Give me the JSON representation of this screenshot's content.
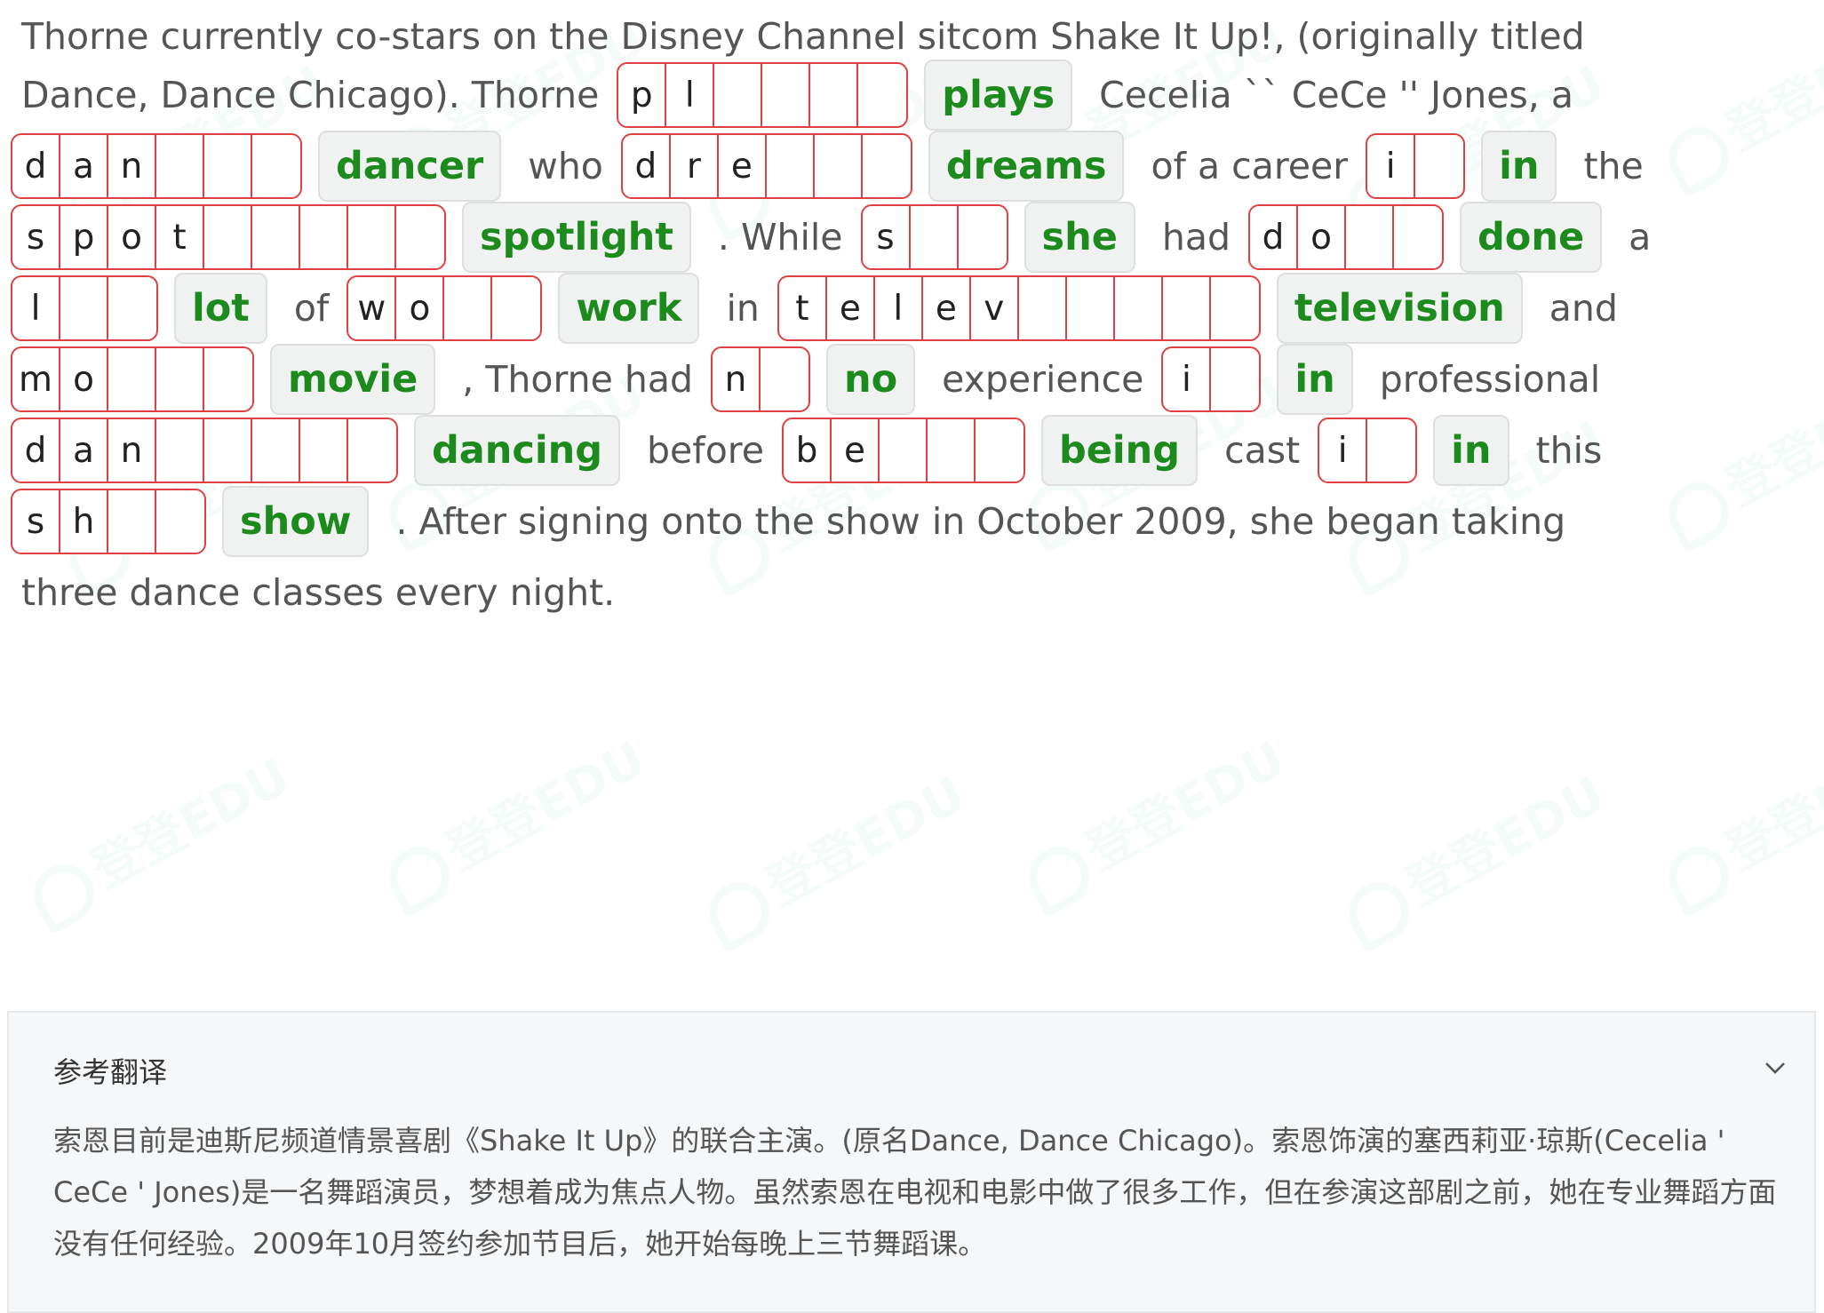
{
  "line1_text": "Thorne currently co-stars on the Disney Channel sitcom Shake It Up!, (originally titled",
  "line2": {
    "pre": "Dance, Dance Chicago). Thorne",
    "blank": {
      "letters": [
        "p",
        "l",
        "",
        "",
        "",
        ""
      ],
      "answer": "plays"
    },
    "post": "Cecelia `` CeCe '' Jones, a"
  },
  "line3": {
    "b1": {
      "letters": [
        "d",
        "a",
        "n",
        "",
        "",
        ""
      ],
      "answer": "dancer"
    },
    "t1": "who",
    "b2": {
      "letters": [
        "d",
        "r",
        "e",
        "",
        "",
        ""
      ],
      "answer": "dreams"
    },
    "t2": "of a career",
    "b3": {
      "letters": [
        "i",
        ""
      ],
      "answer": "in"
    },
    "t3": "the"
  },
  "line4": {
    "b1": {
      "letters": [
        "s",
        "p",
        "o",
        "t",
        "",
        "",
        "",
        "",
        ""
      ],
      "answer": "spotlight"
    },
    "t1": ". While",
    "b2": {
      "letters": [
        "s",
        "",
        ""
      ],
      "answer": "she"
    },
    "t2": "had",
    "b3": {
      "letters": [
        "d",
        "o",
        "",
        ""
      ],
      "answer": "done"
    },
    "t3": "a"
  },
  "line5": {
    "b1": {
      "letters": [
        "l",
        "",
        ""
      ],
      "answer": "lot"
    },
    "t1": "of",
    "b2": {
      "letters": [
        "w",
        "o",
        "",
        ""
      ],
      "answer": "work"
    },
    "t2": "in",
    "b3": {
      "letters": [
        "t",
        "e",
        "l",
        "e",
        "v",
        "",
        "",
        "",
        "",
        ""
      ],
      "answer": "television"
    },
    "t3": "and"
  },
  "line6": {
    "b1": {
      "letters": [
        "m",
        "o",
        "",
        "",
        ""
      ],
      "answer": "movie"
    },
    "t1": ", Thorne had",
    "b2": {
      "letters": [
        "n",
        ""
      ],
      "answer": "no"
    },
    "t2": "experience",
    "b3": {
      "letters": [
        "i",
        ""
      ],
      "answer": "in"
    },
    "t3": "professional"
  },
  "line7": {
    "b1": {
      "letters": [
        "d",
        "a",
        "n",
        "",
        "",
        "",
        "",
        ""
      ],
      "answer": "dancing"
    },
    "t1": "before",
    "b2": {
      "letters": [
        "b",
        "e",
        "",
        "",
        ""
      ],
      "answer": "being"
    },
    "t2": "cast",
    "b3": {
      "letters": [
        "i",
        ""
      ],
      "answer": "in"
    },
    "t3": "this"
  },
  "line8": {
    "b1": {
      "letters": [
        "s",
        "h",
        "",
        ""
      ],
      "answer": "show"
    },
    "t1": ". After signing onto the show in October 2009, she began taking"
  },
  "line9_text": "three dance classes every night.",
  "translation": {
    "title": "参考翻译",
    "text": "索恩目前是迪斯尼频道情景喜剧《Shake It Up》的联合主演。(原名Dance, Dance Chicago)。索恩饰演的塞西莉亚·琼斯(Cecelia ' CeCe ' Jones)是一名舞蹈演员，梦想着成为焦点人物。虽然索恩在电视和电影中做了很多工作，但在参演这部剧之前，她在专业舞蹈方面没有任何经验。2009年10月签约参加节目后，她开始每晚上三节舞蹈课。"
  },
  "watermark_text": "登登EDU",
  "colors": {
    "blank_border": "#e04040",
    "answer_text": "#1c8a1c",
    "answer_bg": "#f0f1f1"
  },
  "icons": {
    "collapse": "chevron-down-icon"
  }
}
